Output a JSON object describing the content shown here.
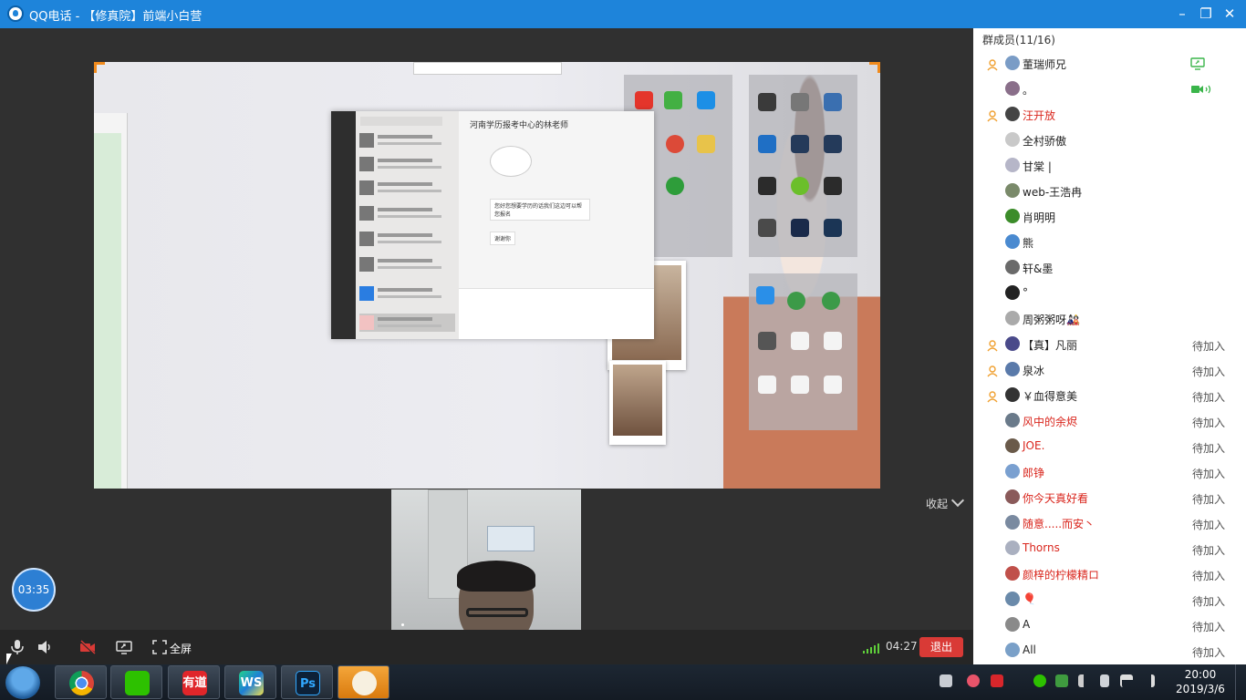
{
  "window": {
    "title": "QQ电话 - 【修真院】前端小白营",
    "icon": "qq-phone-icon",
    "controls": [
      "minimize-icon",
      "maximize-icon",
      "close-icon"
    ]
  },
  "shared_screen": {
    "chat_window_title": "河南学历报考中心的林老师",
    "chat_messages": [
      "您好您想要学历的话我们这边可以帮您报名",
      "谢谢你"
    ],
    "chat_items": [
      "河南学历报考中心",
      "文件传输助手",
      "产品中心",
      "学历提升群",
      "考研交流群",
      "订阅号",
      "河南学历报考中心的林..."
    ]
  },
  "call": {
    "timer": "03:35",
    "collapse_label": "收起",
    "fullscreen_label": "全屏",
    "duration": "04:27",
    "exit_label": "退出"
  },
  "members": {
    "header": "群成员(11/16)",
    "rows": [
      {
        "name": "董瑞师兄",
        "status": "",
        "color": "black",
        "user_icon": true,
        "right_icon": "screen-share-icon"
      },
      {
        "name": "。",
        "status": "",
        "color": "black",
        "user_icon": false,
        "right_icon": "video-speaking-icon"
      },
      {
        "name": "汪开放",
        "status": "",
        "color": "red",
        "user_icon": true,
        "right_icon": ""
      },
      {
        "name": "全村骄傲",
        "status": "",
        "color": "black",
        "user_icon": false,
        "right_icon": ""
      },
      {
        "name": "甘棠 |",
        "status": "",
        "color": "black",
        "user_icon": false,
        "right_icon": ""
      },
      {
        "name": "web-王浩冉",
        "status": "",
        "color": "black",
        "user_icon": false,
        "right_icon": ""
      },
      {
        "name": "肖明明",
        "status": "",
        "color": "black",
        "user_icon": false,
        "right_icon": ""
      },
      {
        "name": "熊",
        "status": "",
        "color": "black",
        "user_icon": false,
        "right_icon": ""
      },
      {
        "name": "轩&墨",
        "status": "",
        "color": "black",
        "user_icon": false,
        "right_icon": ""
      },
      {
        "name": "°",
        "status": "",
        "color": "black",
        "user_icon": false,
        "right_icon": ""
      },
      {
        "name": "周粥粥呀🎎",
        "status": "",
        "color": "black",
        "user_icon": false,
        "right_icon": ""
      },
      {
        "name": "【真】凡丽",
        "status": "待加入",
        "color": "black",
        "user_icon": true,
        "right_icon": ""
      },
      {
        "name": "泉冰",
        "status": "待加入",
        "color": "black",
        "user_icon": true,
        "right_icon": ""
      },
      {
        "name": "￥血得意美",
        "status": "待加入",
        "color": "black",
        "user_icon": true,
        "right_icon": ""
      },
      {
        "name": "风中的余烬",
        "status": "待加入",
        "color": "red",
        "user_icon": false,
        "right_icon": ""
      },
      {
        "name": "JOE.",
        "status": "待加入",
        "color": "red",
        "user_icon": false,
        "right_icon": ""
      },
      {
        "name": "郎铮",
        "status": "待加入",
        "color": "red",
        "user_icon": false,
        "right_icon": ""
      },
      {
        "name": "你今天真好看",
        "status": "待加入",
        "color": "red",
        "user_icon": false,
        "right_icon": ""
      },
      {
        "name": "随意.....而安丶",
        "status": "待加入",
        "color": "red",
        "user_icon": false,
        "right_icon": ""
      },
      {
        "name": "Thorns",
        "status": "待加入",
        "color": "red",
        "user_icon": false,
        "right_icon": ""
      },
      {
        "name": "颜梓的柠檬精ロ",
        "status": "待加入",
        "color": "red",
        "user_icon": false,
        "right_icon": ""
      },
      {
        "name": "🎈",
        "status": "待加入",
        "color": "red",
        "user_icon": false,
        "right_icon": ""
      },
      {
        "name": "A",
        "status": "待加入",
        "color": "black",
        "user_icon": false,
        "right_icon": ""
      },
      {
        "name": "All",
        "status": "待加入",
        "color": "black",
        "user_icon": false,
        "right_icon": ""
      }
    ]
  },
  "taskbar": {
    "apps": [
      {
        "name": "chrome",
        "label": ""
      },
      {
        "name": "wechat",
        "label": ""
      },
      {
        "name": "youdao",
        "label": "有道"
      },
      {
        "name": "webstorm",
        "label": "WS"
      },
      {
        "name": "photoshop",
        "label": "Ps"
      },
      {
        "name": "briefcase",
        "label": ""
      }
    ],
    "time": "20:00",
    "date": "2019/3/6"
  },
  "colors": {
    "titlebar": "#1e84da",
    "accent_orange": "#f08a1c",
    "exit_red": "#d93a36",
    "member_red": "#d9251c",
    "timer_blue": "#2d7fd3"
  }
}
